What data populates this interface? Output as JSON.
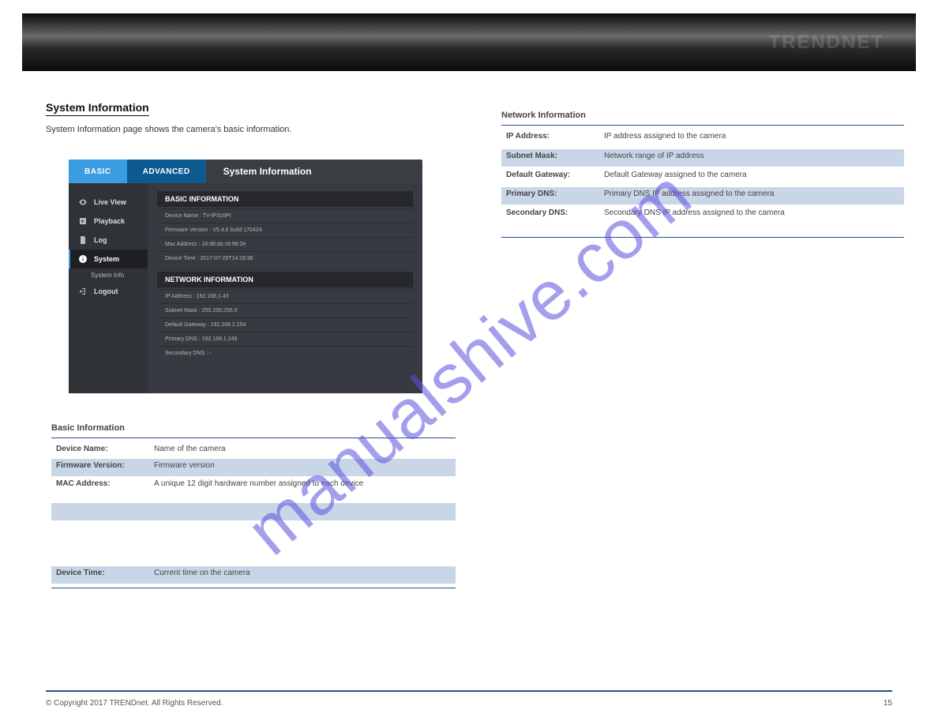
{
  "header": {
    "brand": "TRENDNET"
  },
  "section": {
    "title": "System Information",
    "intro": "System Information page shows the camera's basic information."
  },
  "ui": {
    "tabs": {
      "basic": "BASIC",
      "advanced": "ADVANCED"
    },
    "title": "System Information",
    "side": {
      "live_view": "Live View",
      "playback": "Playback",
      "log": "Log",
      "system": "System",
      "system_sub": "System Info",
      "logout": "Logout"
    },
    "basic_info": {
      "heading": "BASIC INFORMATION",
      "rows": {
        "device_name": {
          "label": "Device Name :",
          "value": "TV-IP316PI"
        },
        "firmware": {
          "label": "Firmware Version :",
          "value": "V5.4.6 build 170424"
        },
        "mac": {
          "label": "Mac Address :",
          "value": "18:d8:ab:c8:98:2e"
        },
        "device_time": {
          "label": "Device Time :",
          "value": "2017-07-29T14:18:36"
        }
      }
    },
    "net_info": {
      "heading": "NETWORK INFORMATION",
      "rows": {
        "ip": {
          "label": "IP Address :",
          "value": "192.168.1.43"
        },
        "mask": {
          "label": "Subnet Mask :",
          "value": "255.255.255.0"
        },
        "gateway": {
          "label": "Default Gateway :",
          "value": "192.168.2.254"
        },
        "dns1": {
          "label": "Primary DNS :",
          "value": "192.168.1.249"
        },
        "dns2": {
          "label": "Secondary DNS :",
          "value": "-"
        }
      }
    }
  },
  "left_table": {
    "title": "Basic Information",
    "device_name": {
      "label": "Device Name:",
      "value": "Name of the camera"
    },
    "firmware": {
      "label": "Firmware Version:",
      "value": "Firmware version"
    },
    "mac": {
      "label": "MAC Address:",
      "value": "A unique 12 digit hardware number assigned to each device"
    },
    "device_time": {
      "label": "Device Time:",
      "value": "Current time on the camera"
    }
  },
  "right_table": {
    "title": "Network Information",
    "ip": {
      "label": "IP Address:",
      "value": "IP address assigned to the camera"
    },
    "mask": {
      "label": "Subnet Mask:",
      "value": "Network range of IP address"
    },
    "gateway": {
      "label": "Default Gateway:",
      "value": "Default Gateway assigned to the camera"
    },
    "dns1": {
      "label": "Primary DNS:",
      "value": "Primary DNS IP address assigned to the camera"
    },
    "dns2": {
      "label": "Secondary DNS:",
      "value": "Secondary DNS IP address assigned to the camera"
    }
  },
  "footer": {
    "left": "© Copyright 2017 TRENDnet. All Rights Reserved.",
    "right": "15"
  },
  "watermark": "manualshive.com"
}
